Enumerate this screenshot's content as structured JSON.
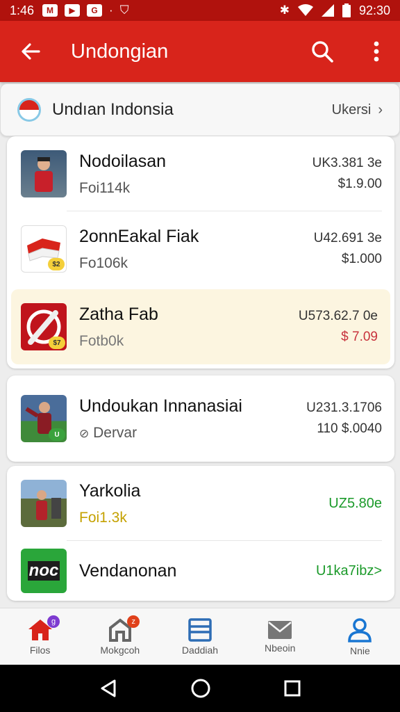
{
  "status_bar": {
    "time": "1:46",
    "clock": "92:30"
  },
  "app_bar": {
    "title": "Undongian"
  },
  "header": {
    "title": "Undıan Indonsia",
    "link": "Ukersi"
  },
  "items": [
    {
      "name": "Nodoilasan",
      "sub": "Foi114k",
      "price1": "UK3.381 3e",
      "price2": "$1.9.00",
      "price2_color": "#333333",
      "sub_color": "#555555"
    },
    {
      "name": "2onnEakal Fiak",
      "sub": "Fo106k",
      "price1": "U42.691 3e",
      "price2": "$1.000",
      "badge": "$2",
      "price2_color": "#333333",
      "sub_color": "#555555"
    },
    {
      "name": "Zatha Fab",
      "sub": "Fotb0k",
      "price1": "U573.62.7 0e",
      "price2": "$ 7.09",
      "badge": "$7",
      "price2_color": "#c8323c",
      "sub_color": "#777777"
    },
    {
      "name": "Undoukan Innanasiai",
      "sub": "Dervar",
      "price1": "U231.3.1706",
      "price2": "110 $.0040",
      "badge": "U",
      "price2_color": "#333333",
      "sub_color": "#555555"
    },
    {
      "name": "Yarkolia",
      "sub": "Foi1.3k",
      "price1": "UZ5.80e",
      "price2": "",
      "price1_color": "#1b9a2a",
      "sub_color": "#c4a100"
    },
    {
      "name": "Vendanonan",
      "sub": "",
      "price1": "U1ka7ibz>",
      "price2": "",
      "thumb_text": "noc",
      "price1_color": "#1b9a2a",
      "sub_color": "#555555"
    }
  ],
  "bottom_nav": [
    {
      "label": "Filos",
      "icon": "home-icon",
      "badge": "g",
      "color": "#d8241b",
      "badge_color": "#7e3bd0"
    },
    {
      "label": "Mokgcoh",
      "icon": "store-icon",
      "badge": "z",
      "color": "#666666",
      "badge_color": "#e0411b"
    },
    {
      "label": "Daddiah",
      "icon": "list-icon",
      "badge": "",
      "color": "#2d6db5"
    },
    {
      "label": "Nbeoin",
      "icon": "mail-icon",
      "badge": "",
      "color": "#666666"
    },
    {
      "label": "Nnie",
      "icon": "person-icon",
      "badge": "",
      "color": "#1976d2"
    }
  ],
  "colors": {
    "primary": "#d8241b",
    "status_bar": "#b0120d",
    "highlight": "#fcf5e0",
    "green": "#1b9a2a"
  }
}
